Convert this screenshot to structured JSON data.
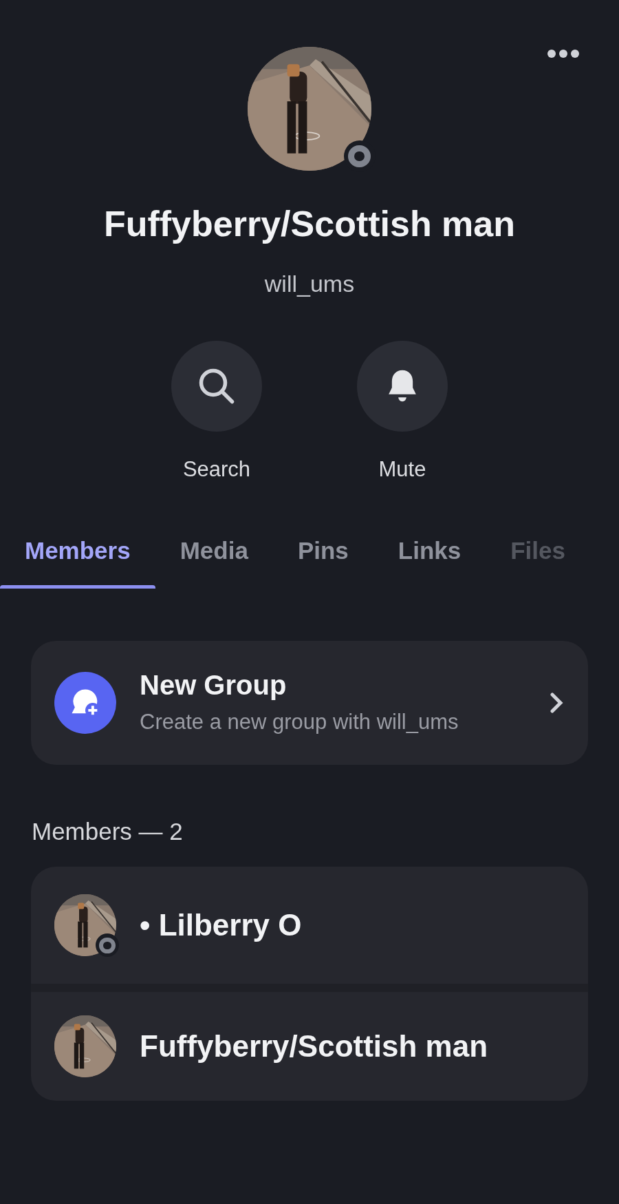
{
  "header": {
    "display_name": "Fuffyberry/Scottish man",
    "username": "will_ums",
    "avatar": {
      "kind": "picture",
      "status_ring": true
    }
  },
  "actions": [
    {
      "kind": "search",
      "label": "Search"
    },
    {
      "kind": "bell",
      "label": "Mute"
    }
  ],
  "tabs": [
    {
      "label": "Members",
      "selected": true
    },
    {
      "label": "Media",
      "selected": false
    },
    {
      "label": "Pins",
      "selected": false
    },
    {
      "label": "Links",
      "selected": false
    },
    {
      "label": "Files",
      "selected": false,
      "faded": true
    }
  ],
  "new_group": {
    "title": "New Group",
    "subtitle": "Create a new group with will_ums"
  },
  "members_heading": "Members — 2",
  "members": [
    {
      "name": "• Lilberry O",
      "status_ring": true
    },
    {
      "name": "Fuffyberry/Scottish man",
      "status_ring": false
    }
  ]
}
